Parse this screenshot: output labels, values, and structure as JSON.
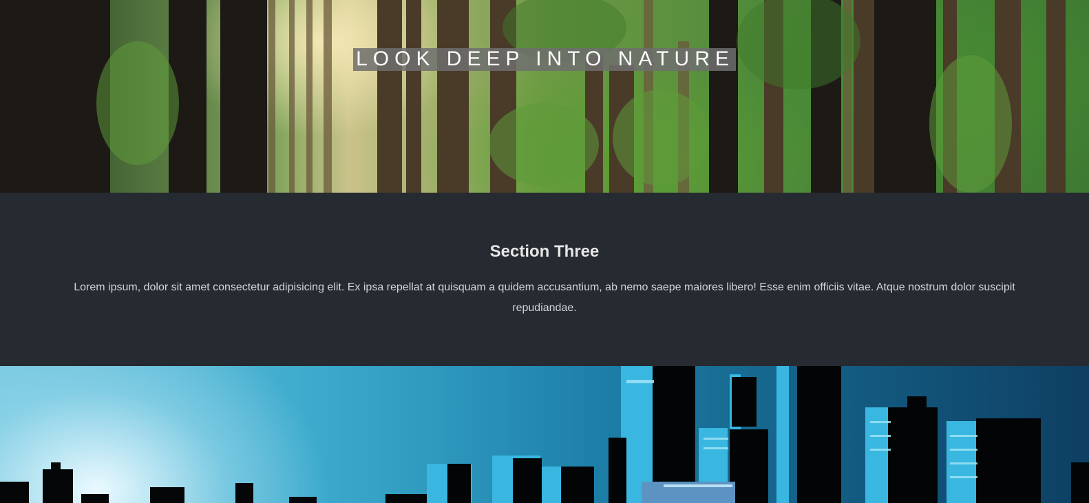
{
  "hero": {
    "title": "LOOK DEEP INTO NATURE",
    "image": "forest-image"
  },
  "section_three": {
    "heading": "Section Three",
    "body": "Lorem ipsum, dolor sit amet consectetur adipisicing elit. Ex ipsa repellat at quisquam a quidem accusantium, ab nemo saepe maiores libero! Esse enim officiis vitae. Atque nostrum dolor suscipit repudiandae."
  },
  "city_banner": {
    "image": "city-skyline-image"
  },
  "colors": {
    "section_background": "#262a31",
    "heading_text": "#e6e6e6",
    "body_text": "#d2d4d8",
    "title_highlight": "#6e6e6e"
  }
}
